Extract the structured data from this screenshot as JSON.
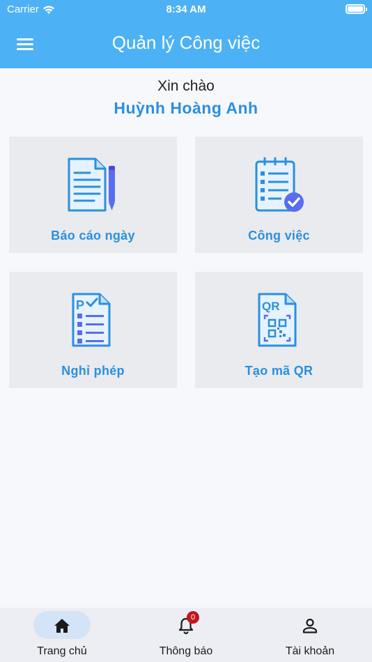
{
  "status_bar": {
    "carrier": "Carrier",
    "time": "8:34 AM"
  },
  "header": {
    "title": "Quản lý Công việc",
    "menu_icon": "hamburger-icon"
  },
  "greeting": {
    "text": "Xin chào",
    "name": "Huỳnh Hoàng Anh"
  },
  "tiles": [
    {
      "label": "Báo cáo ngày",
      "icon": "daily-report-icon"
    },
    {
      "label": "Công việc",
      "icon": "task-checklist-icon"
    },
    {
      "label": "Nghỉ phép",
      "icon": "leave-request-icon"
    },
    {
      "label": "Tạo mã QR",
      "icon": "qr-code-icon"
    }
  ],
  "bottom_nav": {
    "items": [
      {
        "label": "Trang chủ",
        "icon": "home-icon",
        "active": true
      },
      {
        "label": "Thông báo",
        "icon": "bell-icon",
        "badge": "0"
      },
      {
        "label": "Tài khoản",
        "icon": "person-icon"
      }
    ]
  },
  "colors": {
    "header": "#4db1f5",
    "accent": "#2b8fe0",
    "tile": "#e9ebee",
    "badge": "#c4161c"
  }
}
